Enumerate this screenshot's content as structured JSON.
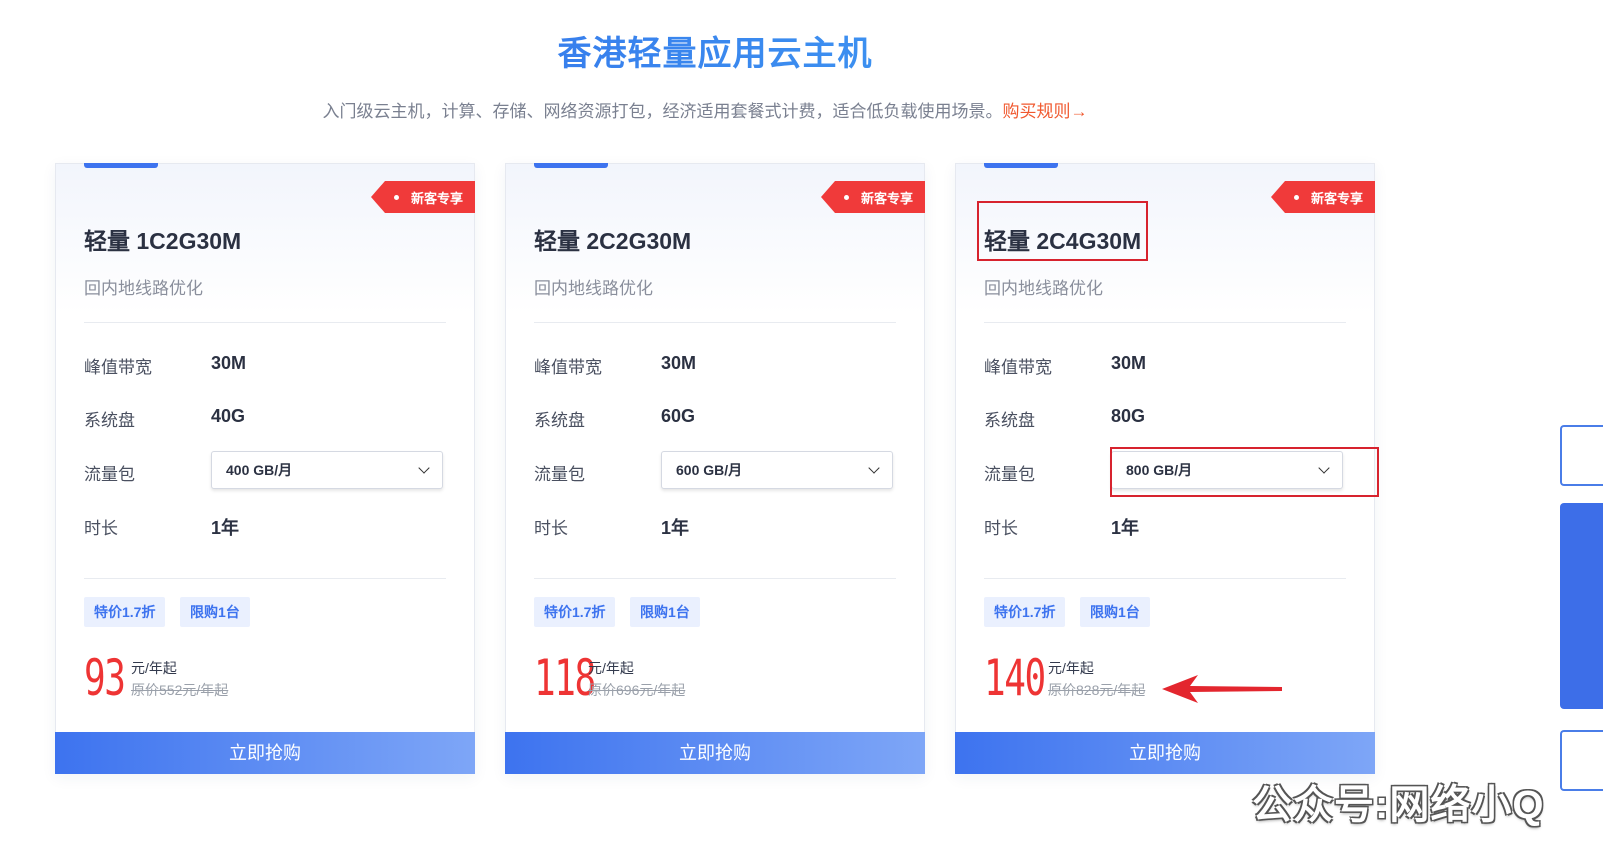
{
  "header": {
    "title": "香港轻量应用云主机",
    "subtitle": "入门级云主机，计算、存储、网络资源打包，经济适用套餐式计费，适合低负载使用场景。",
    "rules_link": "购买规则→"
  },
  "labels": {
    "bandwidth": "峰值带宽",
    "disk": "系统盘",
    "traffic": "流量包",
    "duration": "时长"
  },
  "plans": [
    {
      "badge": "新客专享",
      "name": "轻量 1C2G30M",
      "subtitle": "回内地线路优化",
      "bandwidth": "30M",
      "disk": "40G",
      "traffic": "400 GB/月",
      "duration": "1年",
      "tags": [
        "特价1.7折",
        "限购1台"
      ],
      "price": "93",
      "unit": "元/年起",
      "original": "原价552元/年起",
      "button": "立即抢购"
    },
    {
      "badge": "新客专享",
      "name": "轻量 2C2G30M",
      "subtitle": "回内地线路优化",
      "bandwidth": "30M",
      "disk": "60G",
      "traffic": "600 GB/月",
      "duration": "1年",
      "tags": [
        "特价1.7折",
        "限购1台"
      ],
      "price": "118",
      "unit": "元/年起",
      "original": "原价696元/年起",
      "button": "立即抢购"
    },
    {
      "badge": "新客专享",
      "name": "轻量 2C4G30M",
      "subtitle": "回内地线路优化",
      "bandwidth": "30M",
      "disk": "80G",
      "traffic": "800 GB/月",
      "duration": "1年",
      "tags": [
        "特价1.7折",
        "限购1台"
      ],
      "price": "140",
      "unit": "元/年起",
      "original": "原价828元/年起",
      "button": "立即抢购"
    }
  ],
  "watermark": "公众号:网络小Q",
  "colors": {
    "accent": "#3d73ef",
    "price": "#ee3434",
    "badge": "#f03a3a",
    "annotation": "#d7232e"
  }
}
